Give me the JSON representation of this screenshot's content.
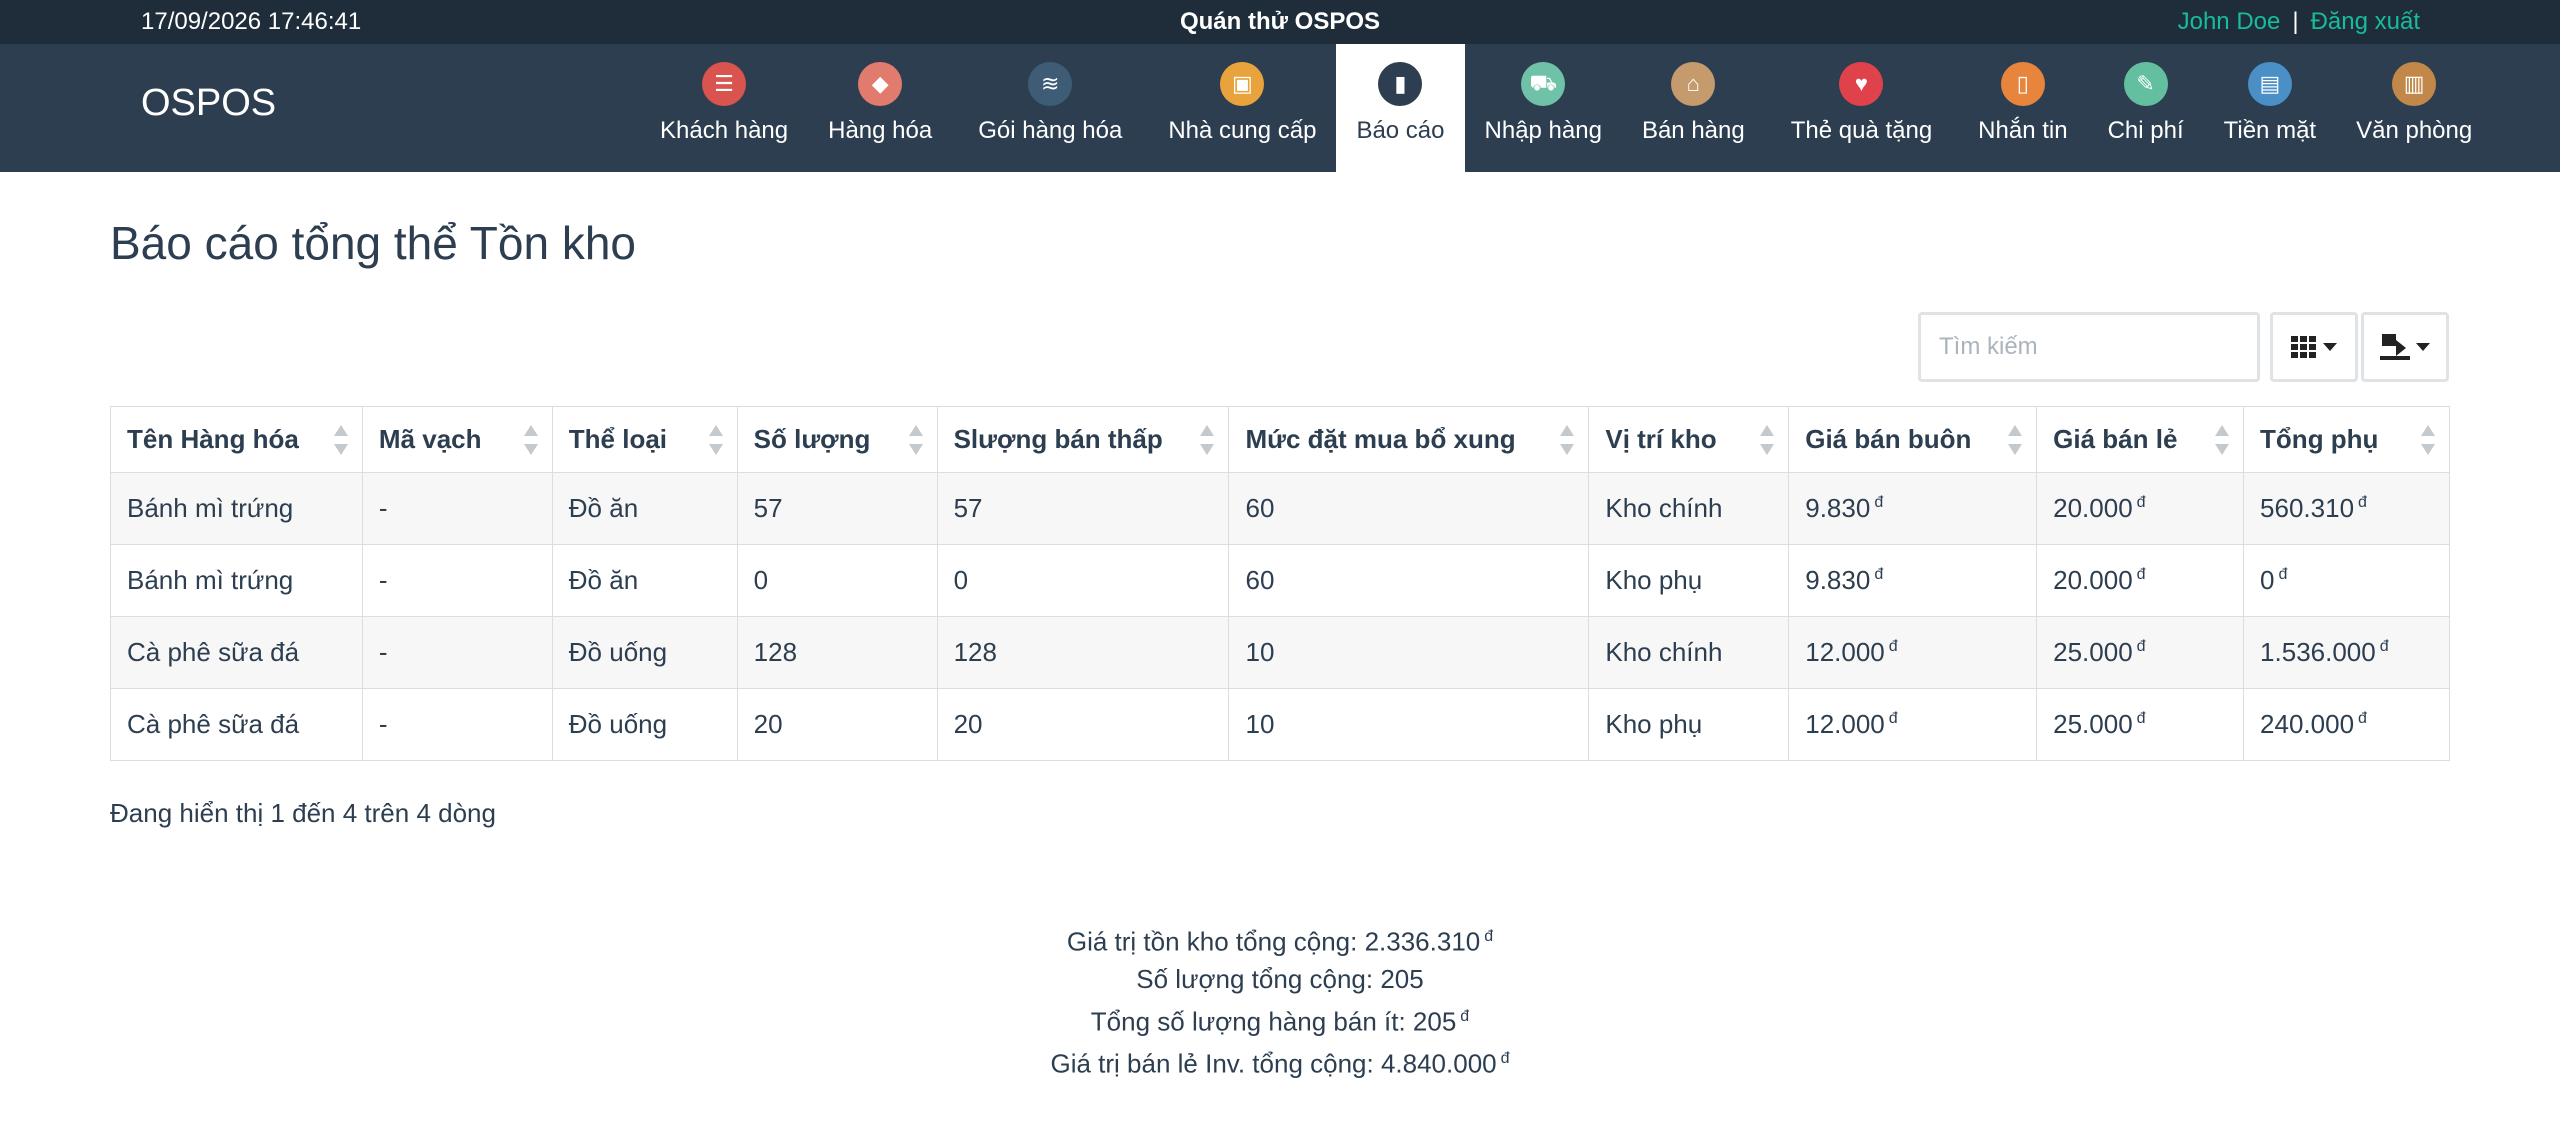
{
  "topbar": {
    "datetime": "17/09/2026 17:46:41",
    "shop_name": "Quán thử OSPOS",
    "user_name": "John Doe",
    "separator": "|",
    "logout": "Đăng xuất"
  },
  "brand": "OSPOS",
  "nav": [
    {
      "label": "Khách hàng",
      "icon": "address-book-icon",
      "color": "#d9534f",
      "glyph": "☰"
    },
    {
      "label": "Hàng hóa",
      "icon": "price-tag-icon",
      "color": "#e07b6e",
      "glyph": "◆"
    },
    {
      "label": "Gói hàng hóa",
      "icon": "layers-icon",
      "color": "#3e5c76",
      "glyph": "≋"
    },
    {
      "label": "Nhà cung cấp",
      "icon": "briefcase-icon",
      "color": "#e8a33d",
      "glyph": "▣"
    },
    {
      "label": "Báo cáo",
      "icon": "bar-chart-icon",
      "color": "#2c3e50",
      "glyph": "▮",
      "active": true
    },
    {
      "label": "Nhập hàng",
      "icon": "hand-truck-icon",
      "color": "#6fc2a8",
      "glyph": "⛟"
    },
    {
      "label": "Bán hàng",
      "icon": "basket-icon",
      "color": "#c59a6d",
      "glyph": "⌂"
    },
    {
      "label": "Thẻ quà tặng",
      "icon": "heart-icon",
      "color": "#e0424b",
      "glyph": "♥"
    },
    {
      "label": "Nhắn tin",
      "icon": "phone-icon",
      "color": "#e8853d",
      "glyph": "▯"
    },
    {
      "label": "Chi phí",
      "icon": "notepad-icon",
      "color": "#63bfa0",
      "glyph": "✎"
    },
    {
      "label": "Tiền mặt",
      "icon": "cash-register-icon",
      "color": "#4a8fc6",
      "glyph": "▤"
    },
    {
      "label": "Văn phòng",
      "icon": "office-building-icon",
      "color": "#c1884a",
      "glyph": "▥"
    }
  ],
  "page_title": "Báo cáo tổng thể Tồn kho",
  "search": {
    "placeholder": "Tìm kiếm"
  },
  "table": {
    "columns": [
      "Tên Hàng hóa",
      "Mã vạch",
      "Thể loại",
      "Số lượng",
      "Slượng bán thấp",
      "Mức đặt mua bổ xung",
      "Vị trí kho",
      "Giá bán buôn",
      "Giá bán lẻ",
      "Tổng phụ"
    ],
    "currency_symbol": "đ",
    "rows": [
      [
        "Bánh mì trứng",
        "-",
        "Đồ ăn",
        "57",
        "57",
        "60",
        "Kho chính",
        "9.830",
        "20.000",
        "560.310"
      ],
      [
        "Bánh mì trứng",
        "-",
        "Đồ ăn",
        "0",
        "0",
        "60",
        "Kho phụ",
        "9.830",
        "20.000",
        "0"
      ],
      [
        "Cà phê sữa đá",
        "-",
        "Đồ uống",
        "128",
        "128",
        "10",
        "Kho chính",
        "12.000",
        "25.000",
        "1.536.000"
      ],
      [
        "Cà phê sữa đá",
        "-",
        "Đồ uống",
        "20",
        "20",
        "10",
        "Kho phụ",
        "12.000",
        "25.000",
        "240.000"
      ]
    ]
  },
  "pagination_info": "Đang hiển thị 1 đến 4 trên 4 dòng",
  "summary": [
    "Giá trị tồn kho tổng cộng: 2.336.310",
    "Số lượng tổng cộng: 205",
    "Tổng số lượng hàng bán ít: 205",
    "Giá trị bán lẻ Inv. tổng cộng: 4.840.000"
  ],
  "summary_currency": [
    true,
    false,
    true,
    true
  ]
}
